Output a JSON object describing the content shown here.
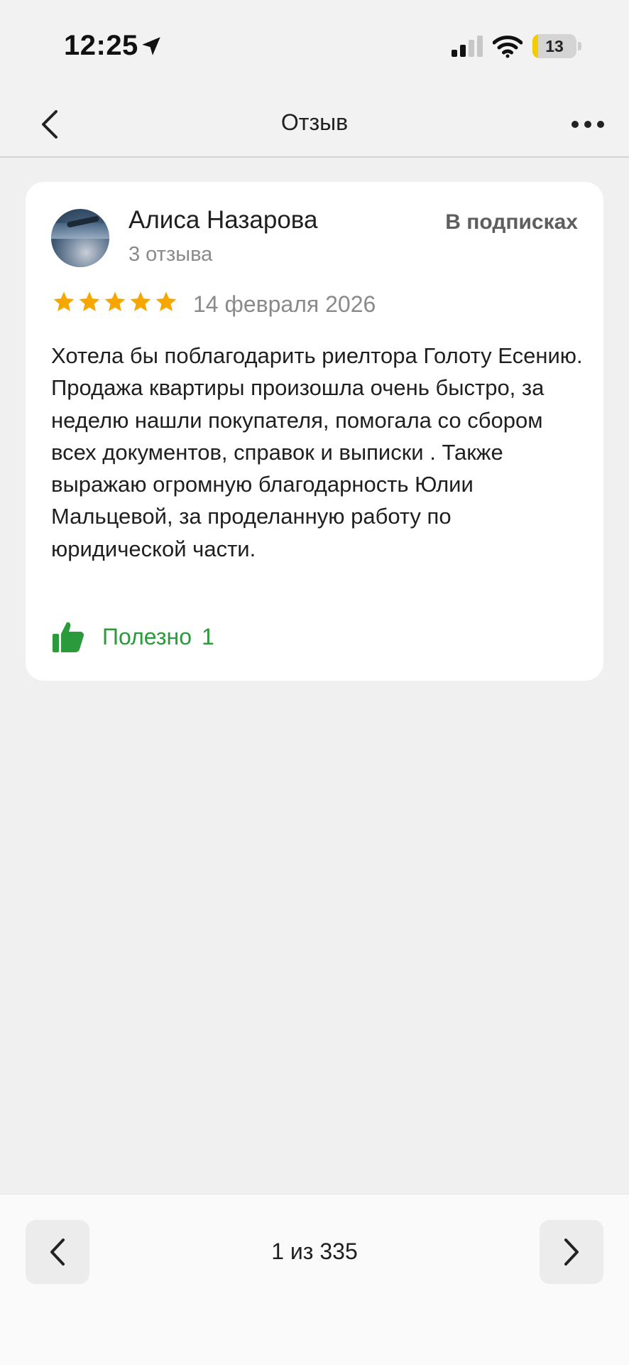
{
  "status_bar": {
    "time": "12:25",
    "battery_level": "13",
    "battery_fraction": 0.13
  },
  "header": {
    "title": "Отзыв"
  },
  "review": {
    "author_name": "Алиса Назарова",
    "author_reviews": "3 отзыва",
    "subscription_status": "В подписках",
    "rating": 5,
    "rating_max": 5,
    "date": "14 февраля 2026",
    "text": "Хотела бы поблагодарить риелтора Голоту Есению. Продажа квартиры произошла очень быстро, за неделю нашли покупателя, помогала со сбором всех документов, справок и выписки . Также выражаю огромную благодарность Юлии Мальцевой, за проделанную работу по юридической части.",
    "useful_label": "Полезно",
    "useful_count": "1"
  },
  "pagination": {
    "counter": "1 из 335"
  },
  "colors": {
    "star": "#f5a700",
    "useful": "#2a9a3a",
    "battery": "#f5cc00"
  },
  "icons": [
    "location-arrow-icon",
    "signal-icon",
    "wifi-icon",
    "battery-icon",
    "back-icon",
    "more-icon",
    "star-icon",
    "thumbs-up-icon",
    "chevron-left-icon",
    "chevron-right-icon"
  ]
}
